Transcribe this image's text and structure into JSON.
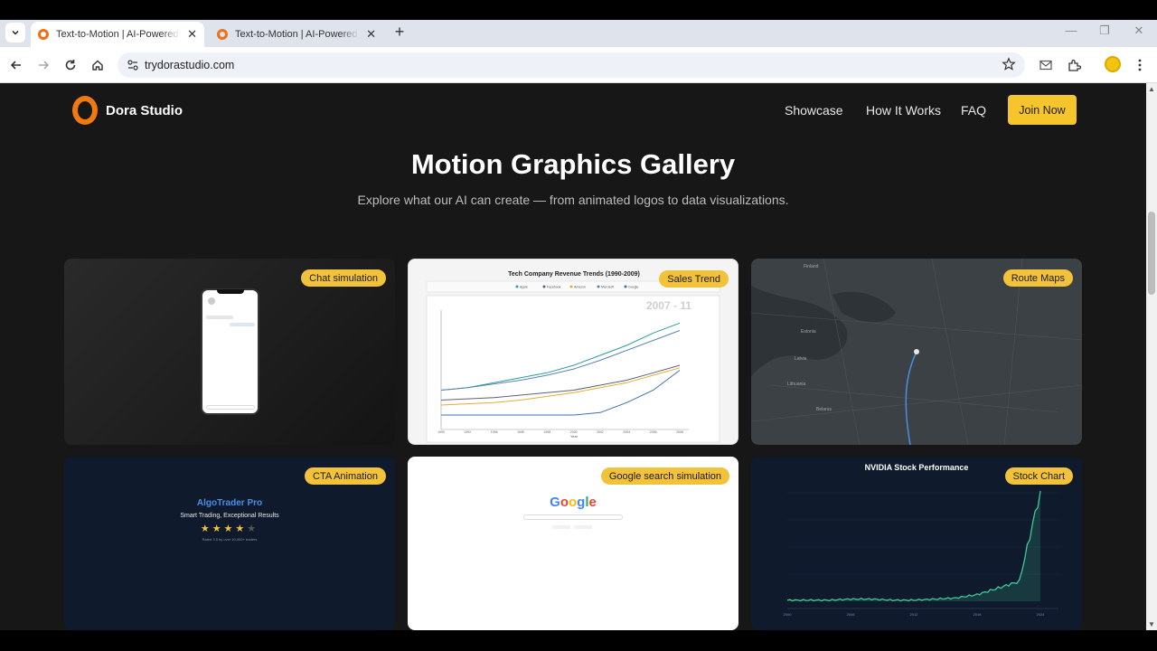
{
  "browser": {
    "tabs": [
      {
        "title": "Text-to-Motion | AI-Powered Motion Graphics",
        "active": true
      },
      {
        "title": "Text-to-Motion | AI-Powered Motion Graphics",
        "active": false
      }
    ],
    "url": "trydorastudio.com"
  },
  "site": {
    "brand": "Dora Studio",
    "nav": [
      "Showcase",
      "How It Works",
      "FAQ"
    ],
    "cta": "Join Now"
  },
  "hero": {
    "title": "Motion Graphics Gallery",
    "subtitle": "Explore what our AI can create — from animated logos to data visualizations."
  },
  "cards": [
    {
      "badge": "Chat simulation"
    },
    {
      "badge": "Sales Trend",
      "chart_title": "Tech Company Revenue Trends (1990-2009)",
      "overlay": "2007 - 11",
      "legend": [
        "Apple",
        "Facebook",
        "Amazon",
        "Microsoft",
        "Google"
      ]
    },
    {
      "badge": "Route Maps",
      "places": [
        "Finland",
        "Estonia",
        "Latvia",
        "Lithuania",
        "Belarus"
      ]
    },
    {
      "badge": "CTA Animation",
      "product": "AlgoTrader Pro",
      "tagline": "Smart Trading, Exceptional Results",
      "rating_text": "Rated 3.5 by over 10,000+ traders"
    },
    {
      "badge": "Google search simulation",
      "logo_letters": [
        "G",
        "o",
        "o",
        "g",
        "l",
        "e"
      ]
    },
    {
      "badge": "Stock Chart",
      "chart_title": "NVIDIA Stock Performance"
    }
  ],
  "colors": {
    "accent": "#f6c42b",
    "brand_orange": "#f07a10",
    "page_bg": "#171717"
  },
  "chart_data": [
    {
      "type": "line",
      "title": "Tech Company Revenue Trends (1990-2009)",
      "x": [
        1990,
        1992,
        1994,
        1996,
        1998,
        2000,
        2002,
        2004,
        2006,
        2008
      ],
      "series": [
        {
          "name": "Apple",
          "values": [
            10,
            11,
            13,
            15,
            17,
            20,
            24,
            28,
            33,
            37
          ]
        },
        {
          "name": "Facebook",
          "values": [
            6,
            6.5,
            7,
            8,
            9,
            10,
            12,
            14,
            17,
            20
          ]
        },
        {
          "name": "Amazon",
          "values": [
            4,
            4.5,
            5,
            6,
            7.5,
            9,
            11,
            13,
            16,
            19
          ]
        },
        {
          "name": "Microsoft",
          "values": [
            10,
            11,
            12.5,
            14,
            16,
            18.5,
            22,
            26,
            30,
            34
          ]
        },
        {
          "name": "Google",
          "values": [
            0,
            0,
            0,
            0,
            0,
            0,
            1,
            5,
            10,
            18
          ]
        }
      ],
      "xlabel": "Year"
    },
    {
      "type": "line",
      "title": "NVIDIA Stock Performance",
      "x": [
        2000,
        2002,
        2004,
        2006,
        2008,
        2010,
        2012,
        2014,
        2016,
        2018,
        2020,
        2022,
        2024
      ],
      "series": [
        {
          "values": [
            1,
            1,
            1,
            2,
            2,
            1,
            1,
            2,
            3,
            6,
            12,
            18,
            100
          ]
        }
      ]
    }
  ]
}
